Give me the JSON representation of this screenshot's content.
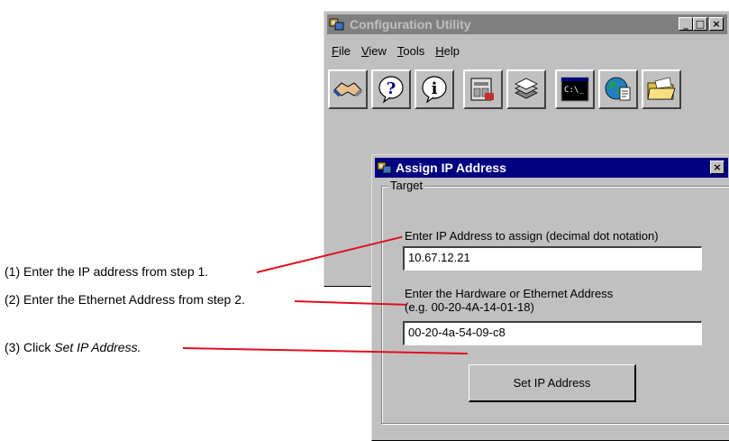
{
  "config_window": {
    "title": "Configuration Utility",
    "title_buttons": [
      "_",
      "□",
      "×"
    ],
    "menu": [
      {
        "label": "File",
        "accel": "F",
        "rest": "ile"
      },
      {
        "label": "View",
        "accel": "V",
        "rest": "iew"
      },
      {
        "label": "Tools",
        "accel": "T",
        "rest": "ools"
      },
      {
        "label": "Help",
        "accel": "H",
        "rest": "elp"
      }
    ],
    "toolbar_icons": [
      "handshake-icon",
      "question-icon",
      "info-icon",
      "device-config-icon",
      "layers-icon",
      "command-prompt-icon",
      "globe-document-icon",
      "open-folder-icon"
    ],
    "console_text": "C:\\_"
  },
  "dialog": {
    "title": "Assign IP Address",
    "close_glyph": "×",
    "group_label": "Target",
    "ip_label": "Enter IP Address to assign (decimal dot notation)",
    "ip_value": "10.67.12.21",
    "hw_label_line1": "Enter the Hardware or Ethernet Address",
    "hw_label_line2": "(e.g. 00-20-4A-14-01-18)",
    "hw_value": "00-20-4a-54-09-c8",
    "set_button": "Set IP Address"
  },
  "callouts": [
    {
      "prefix": "(1) Enter the IP address from step 1.",
      "emphasis": ""
    },
    {
      "prefix": "(2) Enter the Ethernet Address from step 2.",
      "emphasis": ""
    },
    {
      "prefix": "(3) Click ",
      "emphasis": "Set IP Address."
    }
  ],
  "colors": {
    "pointer": "#e0101e",
    "active_title": "#000080",
    "inactive_title": "#808080",
    "face": "#c0c0c0"
  }
}
